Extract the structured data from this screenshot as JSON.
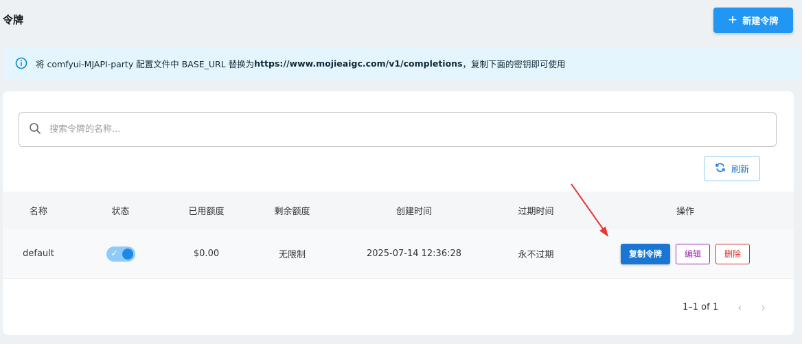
{
  "header": {
    "title": "令牌",
    "new_token_label": "新建令牌"
  },
  "notice": {
    "prefix": "将 comfyui-MJAPI-party 配置文件中 BASE_URL 替换为 ",
    "url": "https://www.mojieaigc.com/v1/completions",
    "suffix": "，复制下面的密钥即可使用"
  },
  "search": {
    "placeholder": "搜索令牌的名称..."
  },
  "refresh_label": "刷新",
  "table": {
    "headers": [
      "名称",
      "状态",
      "已用额度",
      "剩余额度",
      "创建时间",
      "过期时间",
      "操作"
    ],
    "rows": [
      {
        "name": "default",
        "enabled": true,
        "used_quota": "$0.00",
        "remaining_quota": "无限制",
        "created_at": "2025-07-14 12:36:28",
        "expires": "永不过期",
        "copy_label": "复制令牌",
        "edit_label": "编辑",
        "delete_label": "删除"
      }
    ]
  },
  "pagination": {
    "range": "1–1 of 1"
  },
  "icons": {
    "info": "info-icon",
    "search": "search-icon",
    "refresh": "refresh-icon",
    "plus": "plus-icon",
    "toggle_check": "check-icon",
    "prev": "chevron-left-icon",
    "next": "chevron-right-icon",
    "annotation": "red-arrow-icon"
  },
  "colors": {
    "primary": "#2196f3",
    "copy_button": "#1976d2",
    "edit": "#9c27b0",
    "delete": "#d32f2f",
    "notice_bg": "#e5f5fd",
    "annotation_arrow": "#e53935"
  }
}
